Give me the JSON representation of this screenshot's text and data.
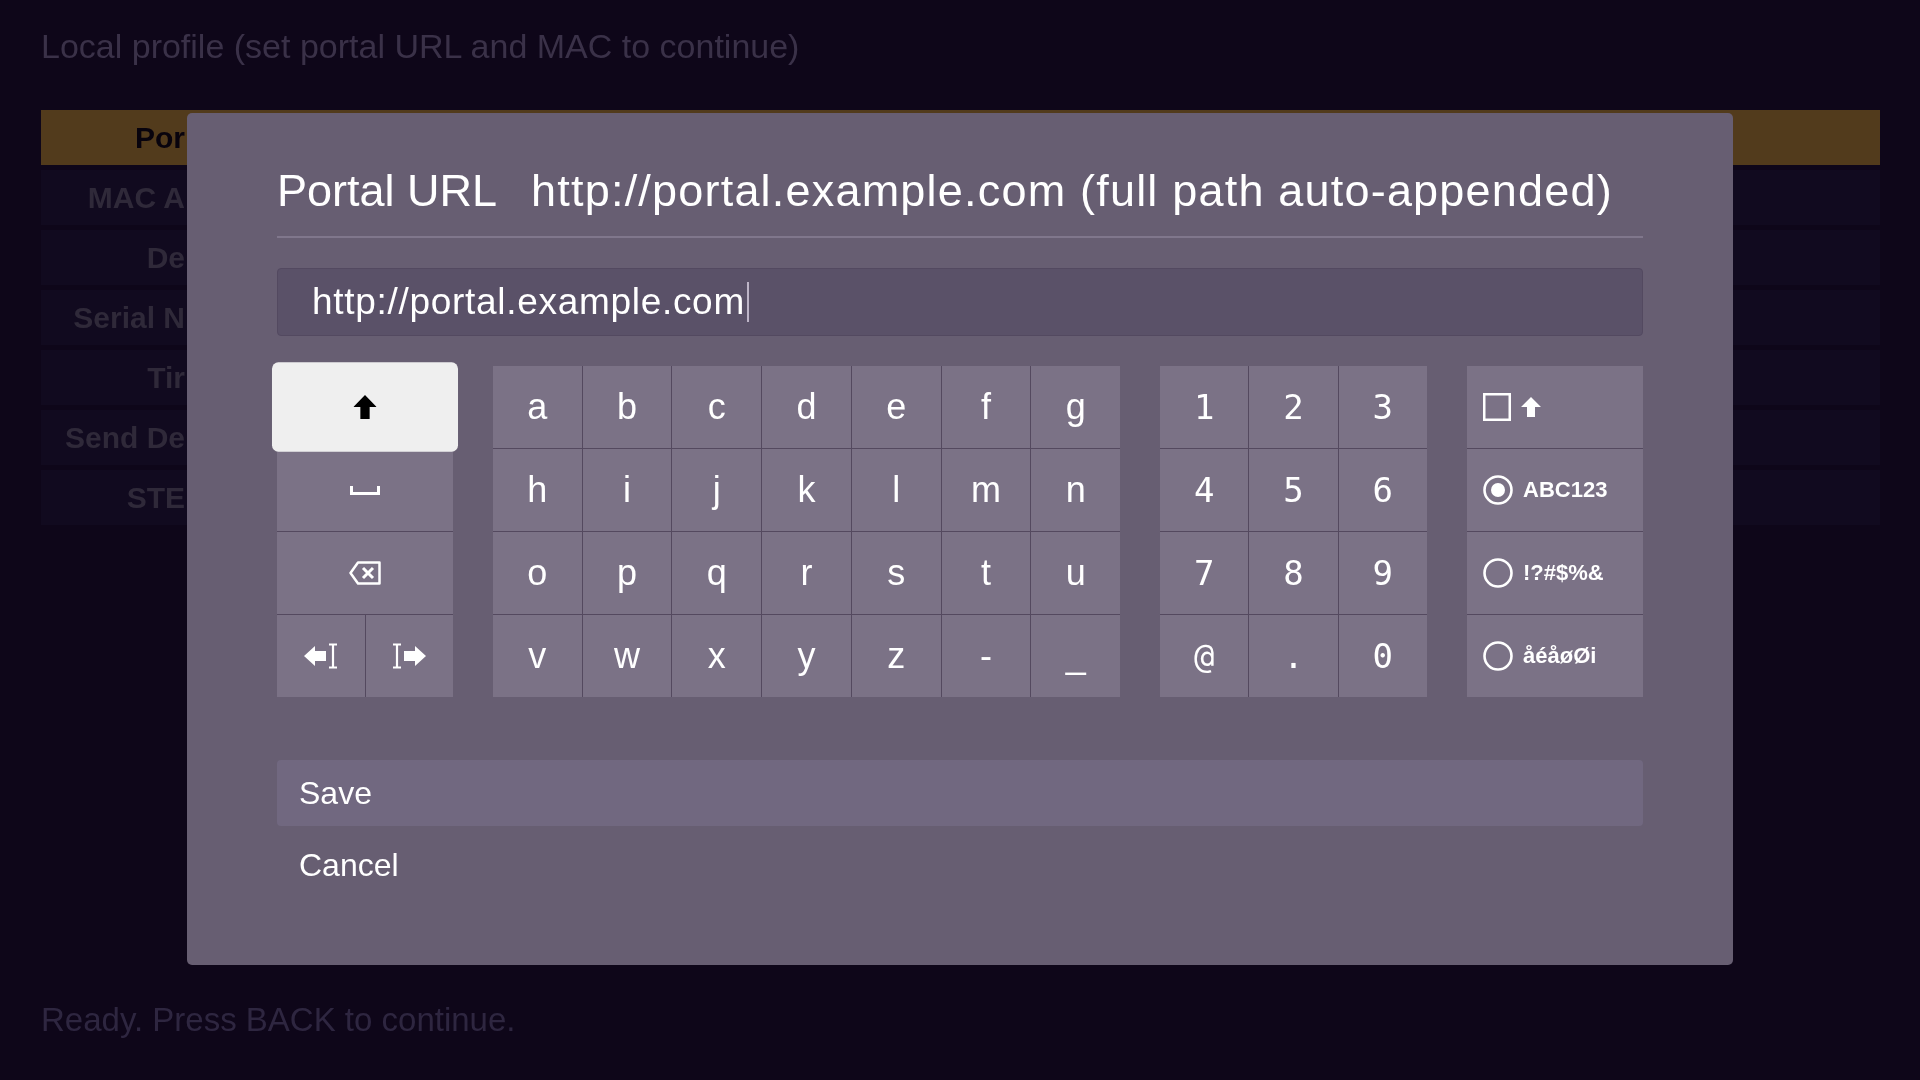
{
  "header": "Local profile (set portal URL and MAC to continue)",
  "settings_list": [
    {
      "label": "Por",
      "selected": true
    },
    {
      "label": "MAC A",
      "selected": false
    },
    {
      "label": "De",
      "selected": false
    },
    {
      "label": "Serial N",
      "selected": false
    },
    {
      "label": "Tir",
      "selected": false
    },
    {
      "label": "Send De",
      "selected": false
    },
    {
      "label": "STE",
      "selected": false
    }
  ],
  "dialog": {
    "title": "Portal URL",
    "subtitle": "http://portal.example.com (full path auto-appended)",
    "input": {
      "value": "http://portal.example.com"
    },
    "keyboard": {
      "control_rows": [
        {
          "keys": [
            {
              "kind": "shift",
              "focused": true
            }
          ]
        },
        {
          "keys": [
            {
              "kind": "space",
              "focused": false
            }
          ]
        },
        {
          "keys": [
            {
              "kind": "backspace",
              "focused": false
            }
          ]
        },
        {
          "keys": [
            {
              "kind": "cursor_left",
              "focused": false
            },
            {
              "kind": "cursor_right",
              "focused": false
            }
          ]
        }
      ],
      "letter_keys": [
        "a",
        "b",
        "c",
        "d",
        "e",
        "f",
        "g",
        "h",
        "i",
        "j",
        "k",
        "l",
        "m",
        "n",
        "o",
        "p",
        "q",
        "r",
        "s",
        "t",
        "u",
        "v",
        "w",
        "x",
        "y",
        "z",
        "-",
        "_"
      ],
      "number_keys": [
        "1",
        "2",
        "3",
        "4",
        "5",
        "6",
        "7",
        "8",
        "9",
        "@",
        ".",
        "0"
      ],
      "modes": [
        {
          "kind": "caps_lock",
          "checked": false
        },
        {
          "kind": "radio",
          "label": "ABC123",
          "selected": true
        },
        {
          "kind": "radio",
          "label": "!?#$%&",
          "selected": false
        },
        {
          "kind": "radio",
          "label": "åéåøØi",
          "selected": false
        }
      ]
    },
    "actions": [
      {
        "label": "Save",
        "selected": true
      },
      {
        "label": "Cancel",
        "selected": false
      }
    ]
  },
  "status": "Ready. Press BACK to continue."
}
